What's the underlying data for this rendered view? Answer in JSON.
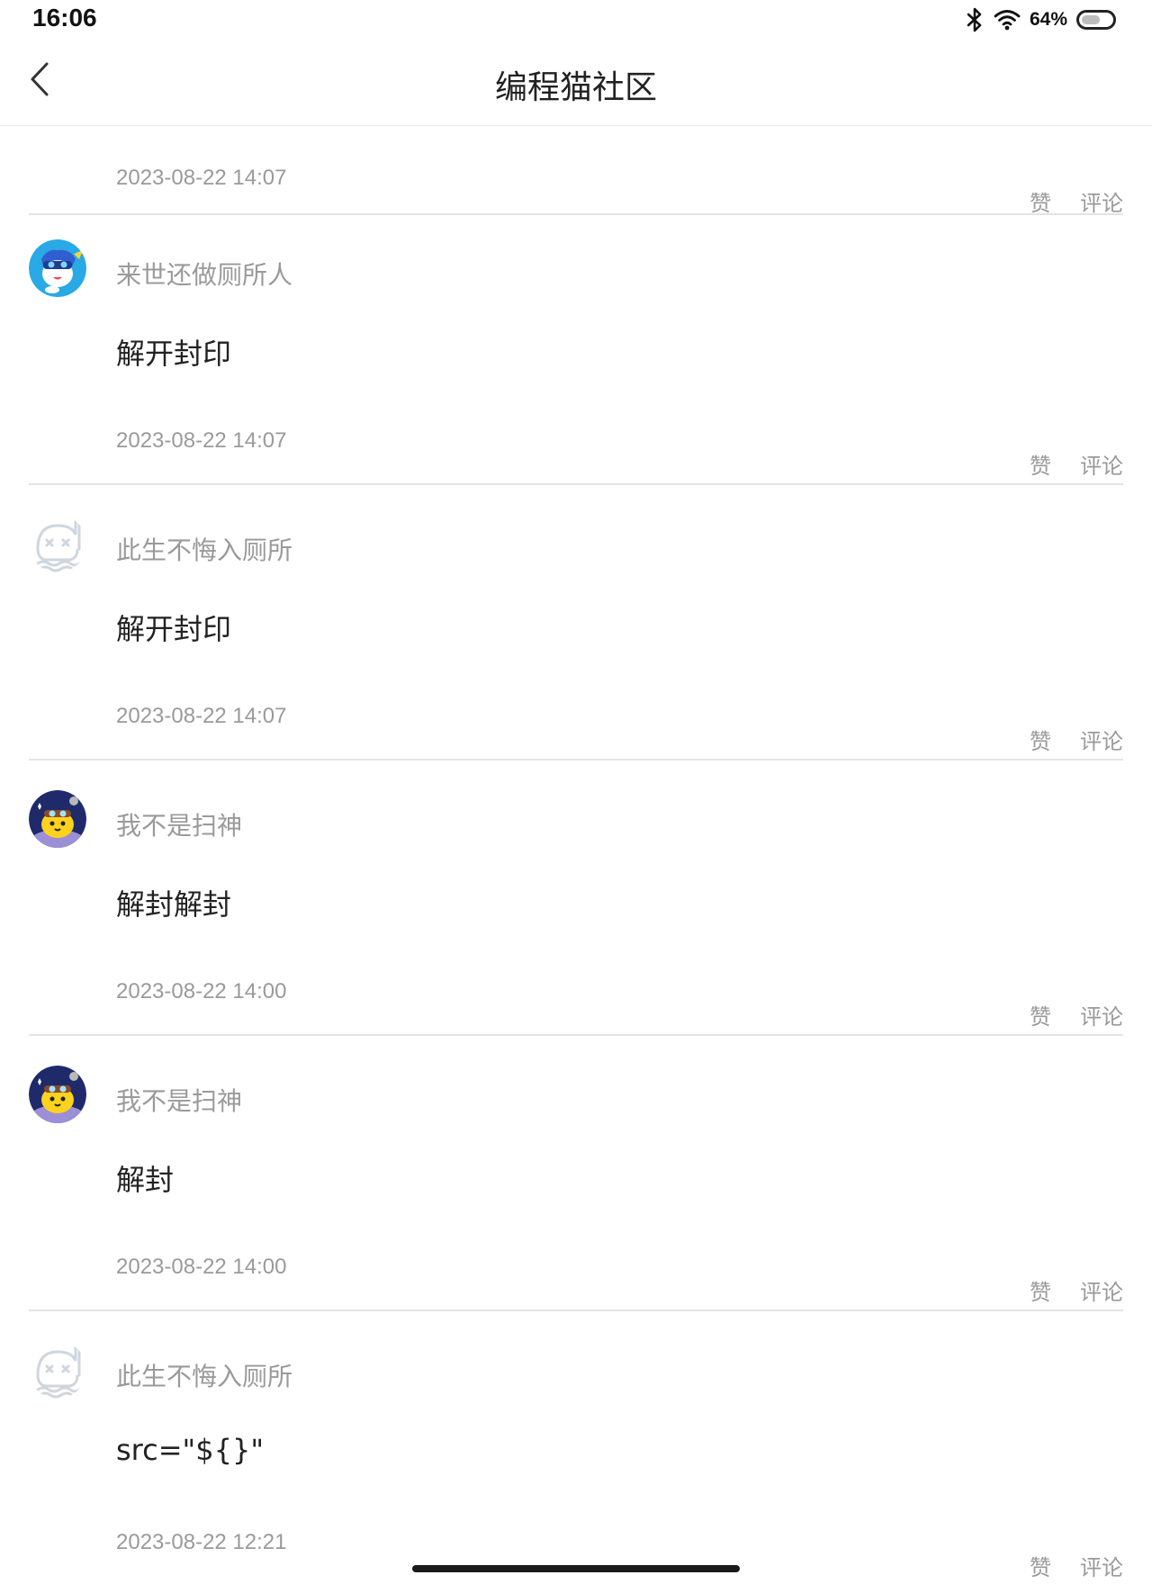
{
  "status_bar": {
    "time": "16:06",
    "battery_percent": "64%",
    "battery_level": 0.64,
    "icons": [
      "bluetooth-icon",
      "wifi-icon",
      "battery-icon"
    ]
  },
  "header": {
    "title": "编程猫社区",
    "back_icon": "chevron-left-icon"
  },
  "actions": {
    "like_label": "赞",
    "comment_label": "评论"
  },
  "colors": {
    "secondary_text": "#9a9a9a",
    "primary_text": "#222222",
    "divider": "#e4e4e4"
  },
  "entries": [
    {
      "timestamp": "2023-08-22 14:07"
    },
    {
      "author": "来世还做厕所人",
      "avatar": "blue-cartoon-avatar",
      "content": "解开封印",
      "timestamp": "2023-08-22 14:07"
    },
    {
      "author": "此生不悔入厕所",
      "avatar": "default-ghost-avatar",
      "content": "解开封印",
      "timestamp": "2023-08-22 14:07"
    },
    {
      "author": "我不是扫神",
      "avatar": "space-cat-avatar",
      "content": "解封解封",
      "timestamp": "2023-08-22 14:00"
    },
    {
      "author": "我不是扫神",
      "avatar": "space-cat-avatar",
      "content": "解封",
      "timestamp": "2023-08-22 14:00"
    },
    {
      "author": "此生不悔入厕所",
      "avatar": "default-ghost-avatar",
      "content": "src=\"${}\"",
      "timestamp": "2023-08-22 12:21"
    }
  ]
}
